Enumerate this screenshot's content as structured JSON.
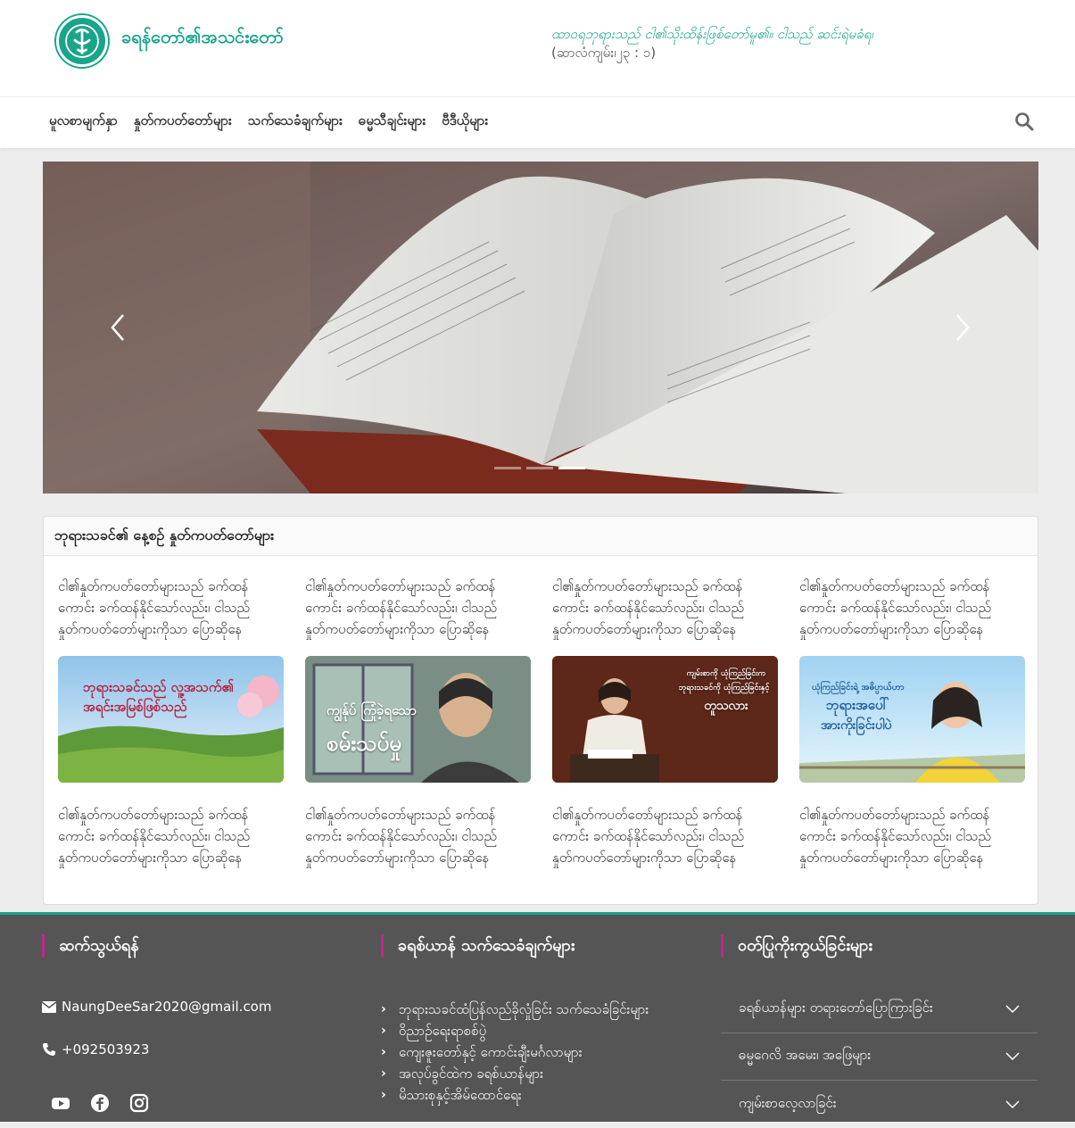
{
  "header": {
    "site_title": "ခရန်တော်၏အသင်းတော်",
    "verse": "ထာဝရဘုရားသည် ငါ၏သိုးထိန်းဖြစ်တော်မူ၏။ ငါသည် ဆင်းရဲမခံရ၊",
    "verse_ref": "(ဆာလံကျမ်း၊၂၃ : ၁)"
  },
  "nav": {
    "items": [
      {
        "label": "မူလစာမျက်နှာ"
      },
      {
        "label": "နှုတ်ကပတ်တော်များ"
      },
      {
        "label": "သက်သေခံချက်များ"
      },
      {
        "label": "ဓမ္မသီချင်းများ"
      },
      {
        "label": "ဗီဒီယိုများ"
      }
    ],
    "search_icon": "search-icon"
  },
  "slider": {
    "slide_count": 3,
    "active_index": 2
  },
  "section": {
    "title": "ဘုရားသခင်၏ နေ့စဉ် နှုတ်ကပတ်တော်များ",
    "excerpt": "ငါ၏နှုတ်ကပတ်တော်များသည် ခက်ထန်ကောင်း ခက်ထန်နိုင်သော်လည်း၊ ငါသည် နှုတ်ကပတ်တော်များကိုသာ ပြောဆိုနေ",
    "cards": [
      {
        "top_text": "ငါ၏နှုတ်ကပတ်တော်များသည် ခက်ထန်ကောင်း ခက်ထန်နိုင်သော်လည်း၊ ငါသည် နှုတ်ကပတ်တော်များကိုသာ ပြောဆိုနေ",
        "thumb_text": "ဘုရားသခင်သည် လူ့အသက်၏ အရင်းအမြစ်ဖြစ်သည်",
        "bottom_text": "ငါ၏နှုတ်ကပတ်တော်များသည် ခက်ထန်ကောင်း ခက်ထန်နိုင်သော်လည်း၊ ငါသည် နှုတ်ကပတ်တော်များကိုသာ ပြောဆိုနေ"
      },
      {
        "top_text": "ငါ၏နှုတ်ကပတ်တော်များသည် ခက်ထန်ကောင်း ခက်ထန်နိုင်သော်လည်း၊ ငါသည် နှုတ်ကပတ်တော်များကိုသာ ပြောဆိုနေ",
        "thumb_text_1": "ကျွန်ုပ် ကြုံခဲ့ရသော",
        "thumb_text_2": "စမ်းသပ်မှု",
        "bottom_text": "ငါ၏နှုတ်ကပတ်တော်များသည် ခက်ထန်ကောင်း ခက်ထန်နိုင်သော်လည်း၊ ငါသည် နှုတ်ကပတ်တော်များကိုသာ ပြောဆိုနေ"
      },
      {
        "top_text": "ငါ၏နှုတ်ကပတ်တော်များသည် ခက်ထန်ကောင်း ခက်ထန်နိုင်သော်လည်း၊ ငါသည် နှုတ်ကပတ်တော်များကိုသာ ပြောဆိုနေ",
        "thumb_text_1": "ကျမ်းစာကို ယုံကြည်ခြင်းက",
        "thumb_text_2": "ဘုရားသခင်ကို ယုံကြည်ခြင်းနှင့်",
        "thumb_text_3": "တူသလား",
        "bottom_text": "ငါ၏နှုတ်ကပတ်တော်များသည် ခက်ထန်ကောင်း ခက်ထန်နိုင်သော်လည်း၊ ငါသည် နှုတ်ကပတ်တော်များကိုသာ ပြောဆိုနေ"
      },
      {
        "top_text": "ငါ၏နှုတ်ကပတ်တော်များသည် ခက်ထန်ကောင်း ခက်ထန်နိုင်သော်လည်း၊ ငါသည် နှုတ်ကပတ်တော်များကိုသာ ပြောဆိုနေ",
        "thumb_text_1": "ယုံကြည်ခြင်းရဲ့ အဓိပ္ပာယ်ဟာ",
        "thumb_text_2": "ဘုရားအပေါ်",
        "thumb_text_3": "အားကိုးခြင်းပါပဲ",
        "bottom_text": "ငါ၏နှုတ်ကပတ်တော်များသည် ခက်ထန်ကောင်း ခက်ထန်နိုင်သော်လည်း၊ ငါသည် နှုတ်ကပတ်တော်များကိုသာ ပြောဆိုနေ"
      }
    ]
  },
  "footer": {
    "contact": {
      "title": "ဆက်သွယ်ရန်",
      "email": "NaungDeeSar2020@gmail.com",
      "phone": "+092503923",
      "social_icons": [
        "youtube-icon",
        "facebook-icon",
        "instagram-icon"
      ]
    },
    "testimonies": {
      "title": "ခရစ်ယာန် သက်သေခံချက်များ",
      "links": [
        {
          "label": "ဘုရားသခင်ထံပြန်လည်ခိုလှုံခြင်း သက်သေခံခြင်းများ"
        },
        {
          "label": "ဝိညာဉ်ရေးရာစစ်ပွဲ"
        },
        {
          "label": "ကျေးဇူးတော်နှင့် ကောင်းချီးမင်္ဂလာများ"
        },
        {
          "label": "အလုပ်ခွင်ထဲက ခရစ်ယာန်များ"
        },
        {
          "label": "မိသားစုနှင့်အိမ်ထောင်ရေး"
        }
      ]
    },
    "support": {
      "title": "ဝတ်ပြုကိုးကွယ်ခြင်းများ",
      "items": [
        {
          "label": "ခရစ်ယာန်များ တရားတော်ပြောကြားခြင်း"
        },
        {
          "label": "ဓမ္မဂေလိ အမေး၊ အဖြေများ"
        },
        {
          "label": "ကျမ်းစာလေ့လာခြင်း"
        }
      ]
    }
  },
  "colors": {
    "accent": "#1aa58a",
    "footer_bg": "#555555",
    "footer_mark": "#c2268e"
  }
}
